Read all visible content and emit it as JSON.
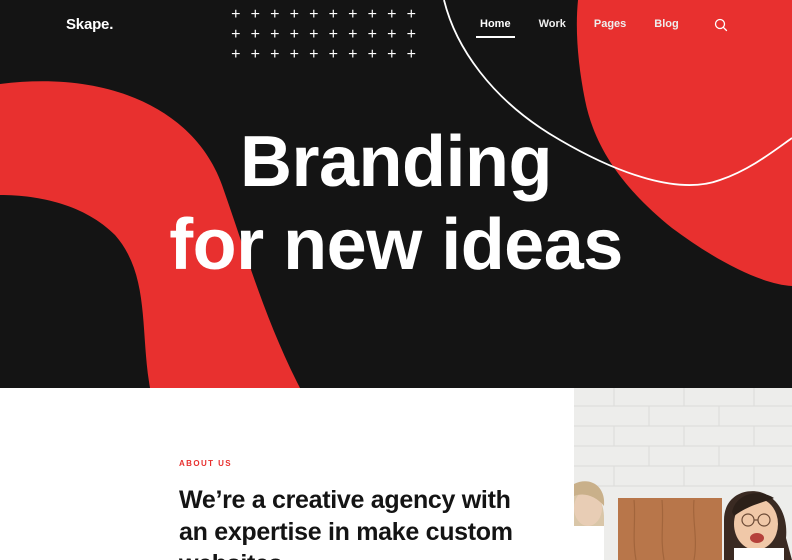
{
  "brand": {
    "logo": "Skape."
  },
  "nav": {
    "items": [
      {
        "label": "Home",
        "active": true
      },
      {
        "label": "Work",
        "active": false
      },
      {
        "label": "Pages",
        "active": false
      },
      {
        "label": "Blog",
        "active": false
      }
    ],
    "search_icon": "search-icon"
  },
  "hero": {
    "headline_line1": "Branding",
    "headline_line2": "for new ideas",
    "decoration": "plus-grid"
  },
  "about": {
    "eyebrow": "ABOUT US",
    "title": "We’re a creative agency with an expertise in make custom websites."
  },
  "colors": {
    "accent": "#e8302f",
    "hero_background": "#141414",
    "text_dark": "#141414",
    "white": "#ffffff"
  }
}
